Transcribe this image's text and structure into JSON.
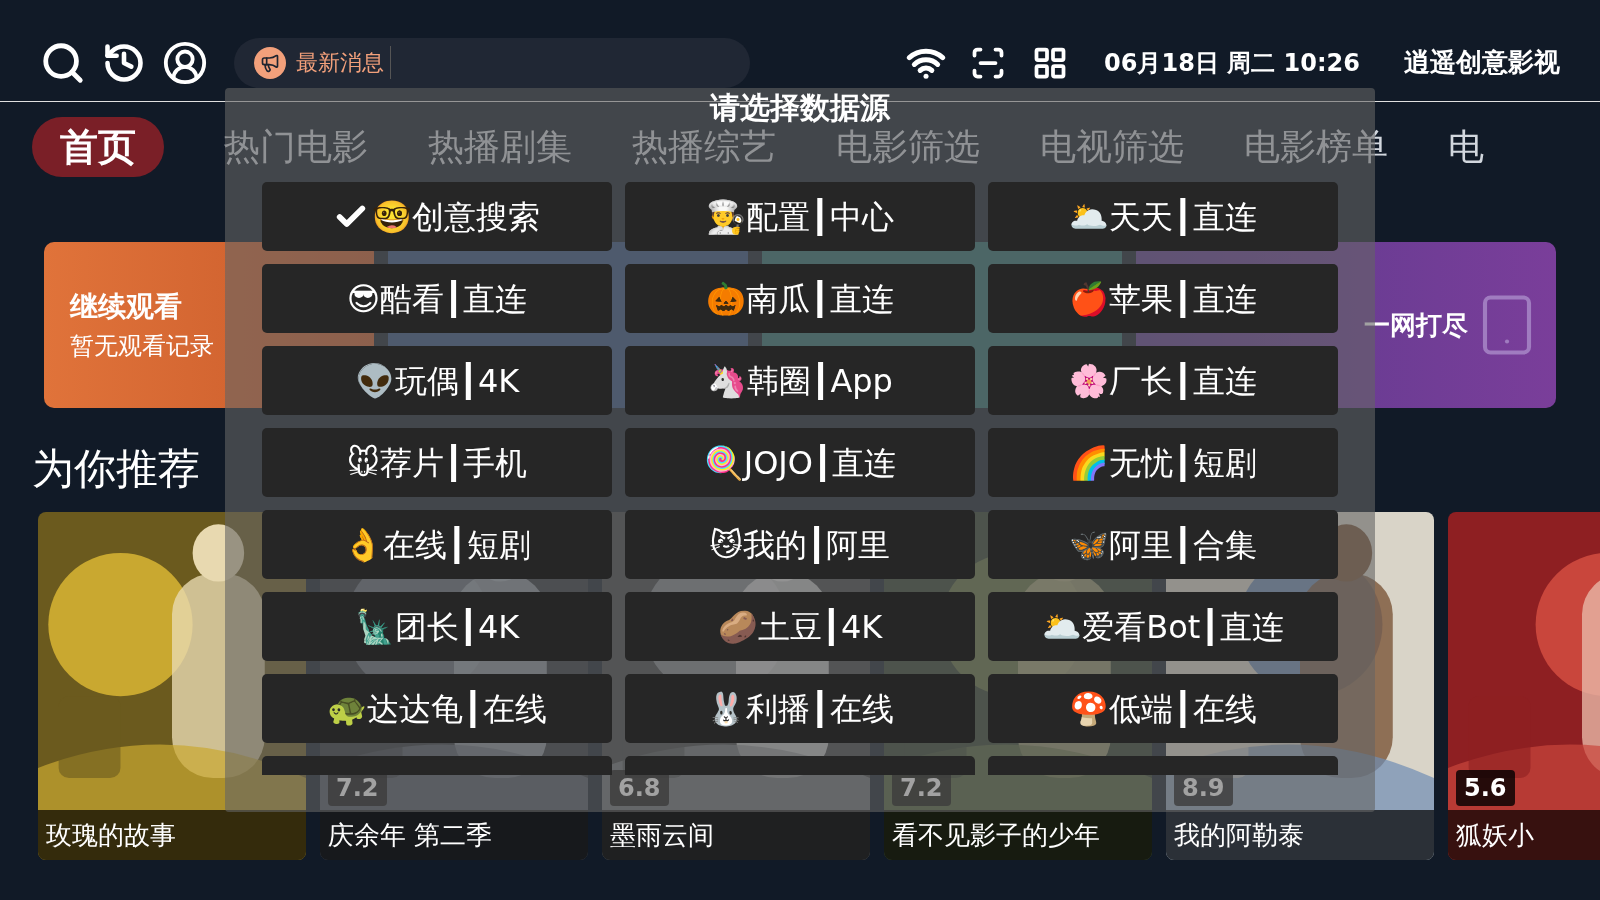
{
  "header": {
    "notice": {
      "text": "最新消息"
    },
    "datetime": "06月18日 周二 10:26",
    "app_name": "逍遥创意影视"
  },
  "tabs": [
    {
      "label": "首页",
      "selected": true
    },
    {
      "label": "热门电影",
      "selected": false
    },
    {
      "label": "热播剧集",
      "selected": false
    },
    {
      "label": "热播综艺",
      "selected": false
    },
    {
      "label": "电影筛选",
      "selected": false
    },
    {
      "label": "电视筛选",
      "selected": false
    },
    {
      "label": "电影榜单",
      "selected": false
    },
    {
      "label": "电",
      "selected": false
    }
  ],
  "banners": {
    "continue": {
      "title": "继续观看",
      "subtitle": "暂无观看记录"
    },
    "live": {
      "text": "一网打尽"
    }
  },
  "section_title": "为你推荐",
  "posters": [
    {
      "title": "玫瑰的故事"
    },
    {
      "title": "庆余年 第二季",
      "rating": "7.2"
    },
    {
      "title": "墨雨云间",
      "rating": "6.8"
    },
    {
      "title": "看不见影子的少年",
      "rating": "7.2"
    },
    {
      "title": "我的阿勒泰",
      "rating": "8.9"
    },
    {
      "title": "狐妖小",
      "rating": "5.6"
    }
  ],
  "dialog": {
    "title": "请选择数据源",
    "sources": [
      {
        "label": "🤓创意搜索",
        "selected": true
      },
      {
        "label": "👨‍🍳配置┃中心",
        "selected": false
      },
      {
        "label": "🌥️天天┃直连",
        "selected": false
      },
      {
        "label": "😎酷看┃直连",
        "selected": false
      },
      {
        "label": "🎃南瓜┃直连",
        "selected": false
      },
      {
        "label": "🍎苹果┃直连",
        "selected": false
      },
      {
        "label": "👽玩偶┃4K",
        "selected": false
      },
      {
        "label": "🦄韩圈┃App",
        "selected": false
      },
      {
        "label": "🌸厂长┃直连",
        "selected": false
      },
      {
        "label": "🐭荐片┃手机",
        "selected": false
      },
      {
        "label": "🍭JOJO┃直连",
        "selected": false
      },
      {
        "label": "🌈无忧┃短剧",
        "selected": false
      },
      {
        "label": "👌在线┃短剧",
        "selected": false
      },
      {
        "label": "😼我的┃阿里",
        "selected": false
      },
      {
        "label": "🦋阿里┃合集",
        "selected": false
      },
      {
        "label": "🗽团长┃4K",
        "selected": false
      },
      {
        "label": "🥔土豆┃4K",
        "selected": false
      },
      {
        "label": "🌥️爱看Bot┃直连",
        "selected": false
      },
      {
        "label": "🐢达达龟┃在线",
        "selected": false
      },
      {
        "label": "🐰利播┃在线",
        "selected": false
      },
      {
        "label": "🍄低端┃在线",
        "selected": false
      }
    ]
  }
}
